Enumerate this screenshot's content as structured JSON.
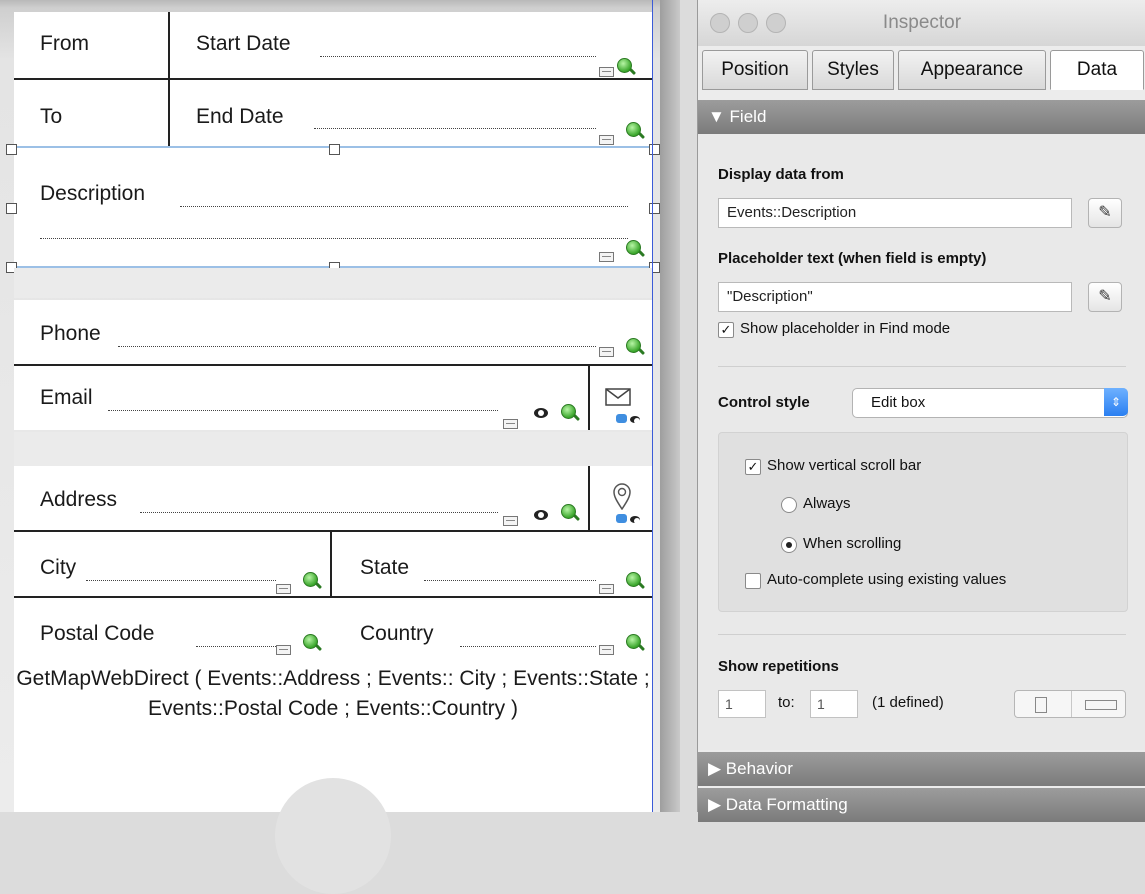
{
  "layout": {
    "labels": {
      "from": "From",
      "to": "To"
    },
    "fields": {
      "start_date": "Start Date",
      "end_date": "End Date",
      "description": "Description",
      "phone": "Phone",
      "email": "Email",
      "address": "Address",
      "city": "City",
      "state": "State",
      "postal_code": "Postal Code",
      "country": "Country"
    },
    "web_viewer_calc": "GetMapWebDirect ( Events::Address ; Events:: City ; Events::State ; Events::Postal Code ; Events::Country )"
  },
  "inspector": {
    "title": "Inspector",
    "tabs": [
      "Position",
      "Styles",
      "Appearance",
      "Data"
    ],
    "active_tab": "Data",
    "sections": {
      "field": "▼ Field",
      "behavior": "▶ Behavior",
      "data_formatting": "▶ Data Formatting"
    },
    "display_data_from": {
      "label": "Display data from",
      "value": "Events::Description"
    },
    "placeholder": {
      "label": "Placeholder text (when field is empty)",
      "value": "\"Description\"",
      "show_in_find_label": "Show placeholder in Find mode",
      "show_in_find_checked": true
    },
    "control_style": {
      "label": "Control style",
      "value": "Edit box"
    },
    "scroll": {
      "show_vertical_label": "Show vertical scroll bar",
      "show_vertical_checked": true,
      "always_label": "Always",
      "when_scrolling_label": "When scrolling",
      "selected": "When scrolling",
      "autocomplete_label": "Auto-complete using existing values",
      "autocomplete_checked": false
    },
    "repetitions": {
      "label": "Show repetitions",
      "from": "1",
      "to_label": "to:",
      "to": "1",
      "defined": "(1 defined)"
    },
    "icons": {
      "edit": "pencil-icon",
      "check": "✓"
    }
  }
}
